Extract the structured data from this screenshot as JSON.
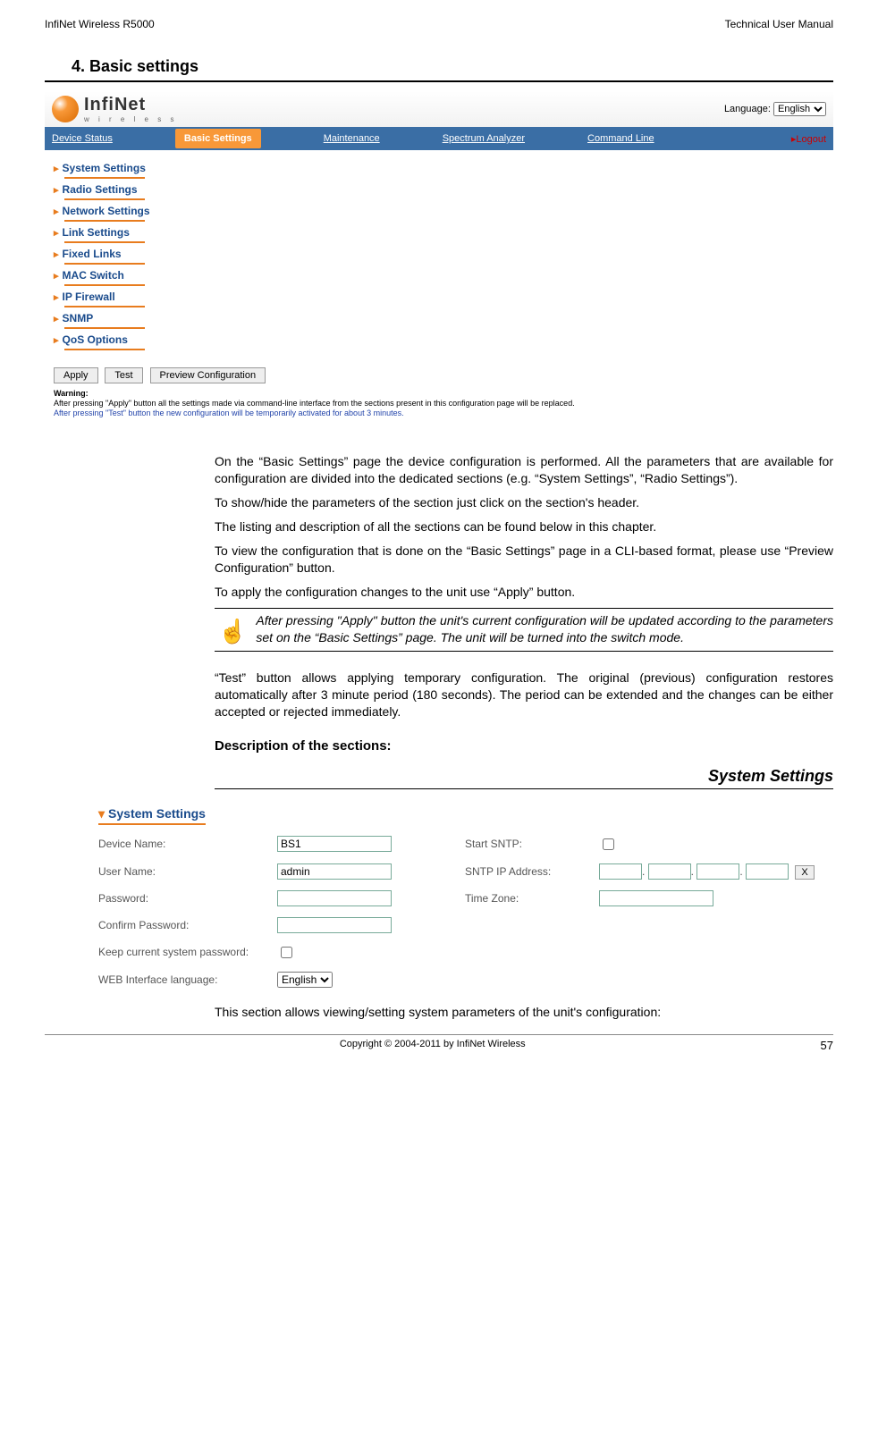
{
  "header": {
    "left": "InfiNet Wireless R5000",
    "right": "Technical User Manual"
  },
  "section_number": "4. Basic settings",
  "screenshot1": {
    "logo_main": "InfiNet",
    "logo_sub": "w i r e l e s s",
    "language_label": "Language:",
    "language_value": "English",
    "nav": {
      "device_status": "Device Status",
      "basic_settings": "Basic Settings",
      "maintenance": "Maintenance",
      "spectrum": "Spectrum Analyzer",
      "command_line": "Command Line",
      "logout": "▸Logout"
    },
    "side_items": [
      "System Settings",
      "Radio Settings",
      "Network Settings",
      "Link Settings",
      "Fixed Links",
      "MAC Switch",
      "IP Firewall",
      "SNMP",
      "QoS Options"
    ],
    "buttons": {
      "apply": "Apply",
      "test": "Test",
      "preview": "Preview Configuration"
    },
    "warning_head": "Warning:",
    "warning_l1": "After pressing \"Apply\" button all the settings made via command-line interface from the sections present in this configuration page will be replaced.",
    "warning_l2": "After pressing \"Test\" button the new configuration will be temporarily activated for about 3 minutes."
  },
  "paragraphs": {
    "p1": "On the “Basic Settings” page the device configuration is performed. All the parameters that are available for configuration are divided into the dedicated sections (e.g. “System Settings”, “Radio Settings”).",
    "p2": "To show/hide the parameters of the section just click on the section's header.",
    "p3": "The listing and description of all the sections can be found below in this chapter.",
    "p4": "To view the configuration that is done on the “Basic Settings” page in a CLI-based format, please use “Preview Configuration” button.",
    "p5": "To apply the configuration changes to the unit use “Apply” button.",
    "note": "After pressing \"Apply\" button the unit's current configuration will be updated according to the parameters set on the “Basic Settings” page. The unit will be turned into the switch mode.",
    "p6": "“Test” button allows applying temporary configuration. The original (previous) configuration restores automatically after 3 minute period (180 seconds). The period can be extended and the changes can be either accepted or rejected immediately.",
    "desc_head": "Description of the sections:",
    "sys_head": "System Settings",
    "p7": "This section allows viewing/setting system parameters of the unit's configuration:"
  },
  "screenshot2": {
    "title": "System Settings",
    "labels": {
      "device_name": "Device Name:",
      "user_name": "User Name:",
      "password": "Password:",
      "confirm": "Confirm Password:",
      "keep": "Keep current system password:",
      "web_lang": "WEB Interface language:",
      "start_sntp": "Start SNTP:",
      "sntp_ip": "SNTP IP Address:",
      "timezone": "Time Zone:",
      "x": "X"
    },
    "values": {
      "device_name": "BS1",
      "user_name": "admin",
      "web_lang": "English"
    }
  },
  "footer": {
    "copyright": "Copyright © 2004-2011 by InfiNet Wireless",
    "page": "57"
  }
}
